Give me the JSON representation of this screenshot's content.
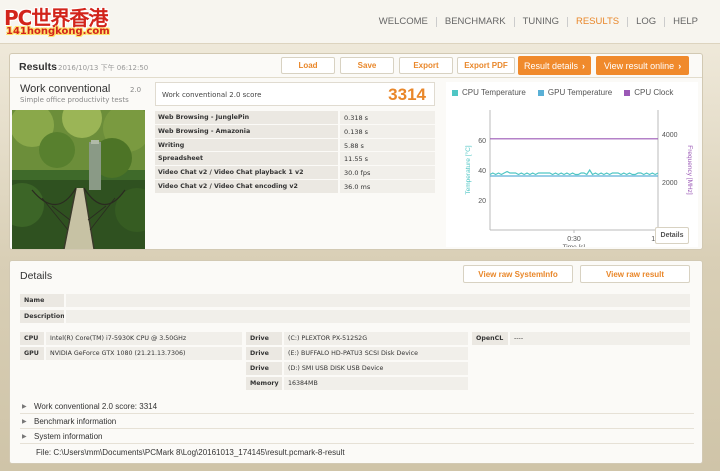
{
  "logo": {
    "line1": "PC世界香港",
    "line2": "141hongkong.com"
  },
  "nav": {
    "items": [
      "WELCOME",
      "BENCHMARK",
      "TUNING",
      "RESULTS",
      "LOG",
      "HELP"
    ],
    "active": "RESULTS"
  },
  "results": {
    "title": "Results",
    "date": "2016/10/13 下午 06:12:50",
    "buttons": {
      "load": "Load",
      "save": "Save",
      "export": "Export",
      "export_pdf": "Export PDF"
    },
    "result_details": "Result details",
    "view_online": "View result online",
    "test": {
      "name": "Work conventional",
      "version": "2.0",
      "subtitle": "Simple office productivity tests"
    },
    "score": {
      "label": "Work conventional 2.0 score",
      "value": "3314"
    },
    "rows": [
      {
        "k": "Web Browsing - JunglePin",
        "v": "0.318 s"
      },
      {
        "k": "Web Browsing - Amazonia",
        "v": "0.138 s"
      },
      {
        "k": "Writing",
        "v": "5.88 s"
      },
      {
        "k": "Spreadsheet",
        "v": "11.55 s"
      },
      {
        "k": "Video Chat v2 / Video Chat playback 1 v2",
        "v": "30.0 fps"
      },
      {
        "k": "Video Chat v2 / Video Chat encoding v2",
        "v": "36.0 ms"
      }
    ],
    "details_button": "Details"
  },
  "chart_data": {
    "type": "line",
    "series": [
      {
        "name": "CPU Temperature",
        "color": "#4fc6c4",
        "axis": "left",
        "values": [
          37,
          38,
          37,
          38,
          37,
          38,
          39,
          38,
          38,
          38,
          37,
          38,
          37,
          38,
          37,
          38,
          37,
          38,
          38,
          38,
          38,
          38,
          37,
          38,
          37,
          38,
          37,
          38,
          37,
          38,
          37,
          37,
          38,
          38,
          37,
          40,
          37,
          38,
          37,
          38,
          37,
          38,
          37,
          38,
          38,
          38,
          37,
          38,
          37,
          38,
          37,
          37,
          38,
          38,
          37,
          38,
          37,
          38,
          37,
          38
        ]
      },
      {
        "name": "GPU Temperature",
        "color": "#5ab0d6",
        "axis": "left",
        "values": [
          36,
          36,
          36,
          36,
          36,
          36,
          36,
          36,
          36,
          36,
          36,
          36,
          36,
          36,
          36,
          36,
          36,
          36,
          36,
          36,
          36,
          36,
          36,
          36,
          36,
          36,
          36,
          36,
          36,
          36,
          36,
          36,
          36,
          36,
          36,
          36,
          36,
          36,
          36,
          36,
          36,
          36,
          36,
          36,
          36,
          36,
          36,
          36,
          36,
          36,
          36,
          36,
          36,
          36,
          36,
          36,
          36,
          36,
          36,
          36
        ]
      },
      {
        "name": "CPU Clock",
        "color": "#9b59b6",
        "axis": "right",
        "values": [
          3800,
          3800,
          3800,
          3800,
          3800,
          3800,
          3800,
          3800,
          3800,
          3800,
          3800,
          3800,
          3800,
          3800,
          3800,
          3800,
          3800,
          3800,
          3800,
          3800,
          3800,
          3800,
          3800,
          3800,
          3800,
          3800,
          3800,
          3800,
          3800,
          3800,
          3800,
          3800,
          3800,
          3800,
          3800,
          3800,
          3800,
          3800,
          3800,
          3800,
          3800,
          3800,
          3800,
          3800,
          3800,
          3800,
          3800,
          3800,
          3800,
          3800,
          3800,
          3800,
          3800,
          3800,
          3800,
          3800,
          3800,
          3800,
          3800,
          3800
        ]
      }
    ],
    "x_range": [
      0,
      60
    ],
    "x_ticks": [
      "0:30",
      "1:00"
    ],
    "xlabel": "Time [s]",
    "ylabel_left": "Temperature [°C]",
    "ylabel_right": "Frequency [MHz]",
    "ylim_left": [
      0,
      80
    ],
    "ylim_right": [
      0,
      5000
    ],
    "y_ticks_left": [
      "60",
      "40",
      "20"
    ],
    "y_ticks_right": [
      "4000",
      "2000"
    ],
    "grid": false,
    "legend": "top"
  },
  "details": {
    "title": "Details",
    "view_sysinfo": "View raw SystemInfo",
    "view_result": "View raw result",
    "name_label": "Name",
    "description_label": "Description",
    "cpu_label": "CPU",
    "cpu": "Intel(R) Core(TM) i7-5930K CPU @ 3.50GHz",
    "gpu_label": "GPU",
    "gpu": "NVIDIA GeForce GTX 1080 (21.21.13.7306)",
    "drives": [
      {
        "k": "Drive",
        "v": "(C:) PLEXTOR PX-512S2G"
      },
      {
        "k": "Drive",
        "v": "(E:) BUFFALO HD-PATU3 SCSI Disk Device"
      },
      {
        "k": "Drive",
        "v": "(D:) SMI USB DISK USB Device"
      },
      {
        "k": "Memory",
        "v": "16384MB"
      }
    ],
    "opencl_label": "OpenCL",
    "opencl": "----",
    "expanders": [
      "Work conventional 2.0 score: 3314",
      "Benchmark information",
      "System information"
    ],
    "file": "File: C:\\Users\\mm\\Documents\\PCMark 8\\Log\\20161013_174145\\result.pcmark-8-result"
  }
}
